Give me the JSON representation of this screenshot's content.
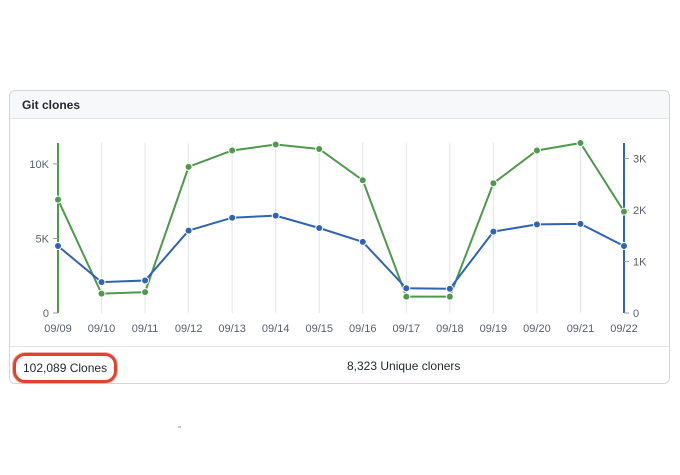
{
  "panel": {
    "title": "Git clones"
  },
  "footer": {
    "clones_label": "102,089 Clones",
    "unique_label": "8,323 Unique cloners"
  },
  "chart_data": {
    "type": "line",
    "title": "Git clones",
    "categories": [
      "09/09",
      "09/10",
      "09/11",
      "09/12",
      "09/13",
      "09/14",
      "09/15",
      "09/16",
      "09/17",
      "09/18",
      "09/19",
      "09/20",
      "09/21",
      "09/22"
    ],
    "series": [
      {
        "name": "Clones",
        "axis": "left",
        "color": "#4c9a4a",
        "values": [
          7600,
          1300,
          1400,
          9800,
          10900,
          11300,
          11000,
          8900,
          1100,
          1100,
          8700,
          10900,
          11400,
          6800
        ]
      },
      {
        "name": "Unique cloners",
        "axis": "right",
        "color": "#2e63b8",
        "values": [
          1300,
          600,
          630,
          1600,
          1850,
          1890,
          1650,
          1380,
          480,
          470,
          1580,
          1720,
          1730,
          1300
        ]
      }
    ],
    "y_left": {
      "ticks": [
        0,
        5000,
        10000
      ],
      "tick_labels": [
        "0",
        "5K",
        "10K"
      ],
      "ylim": [
        0,
        11400
      ]
    },
    "y_right": {
      "ticks": [
        0,
        1000,
        2000,
        3000
      ],
      "tick_labels": [
        "0",
        "1K",
        "2K",
        "3K"
      ],
      "ylim": [
        0,
        3300
      ]
    },
    "grid": "vertical"
  }
}
